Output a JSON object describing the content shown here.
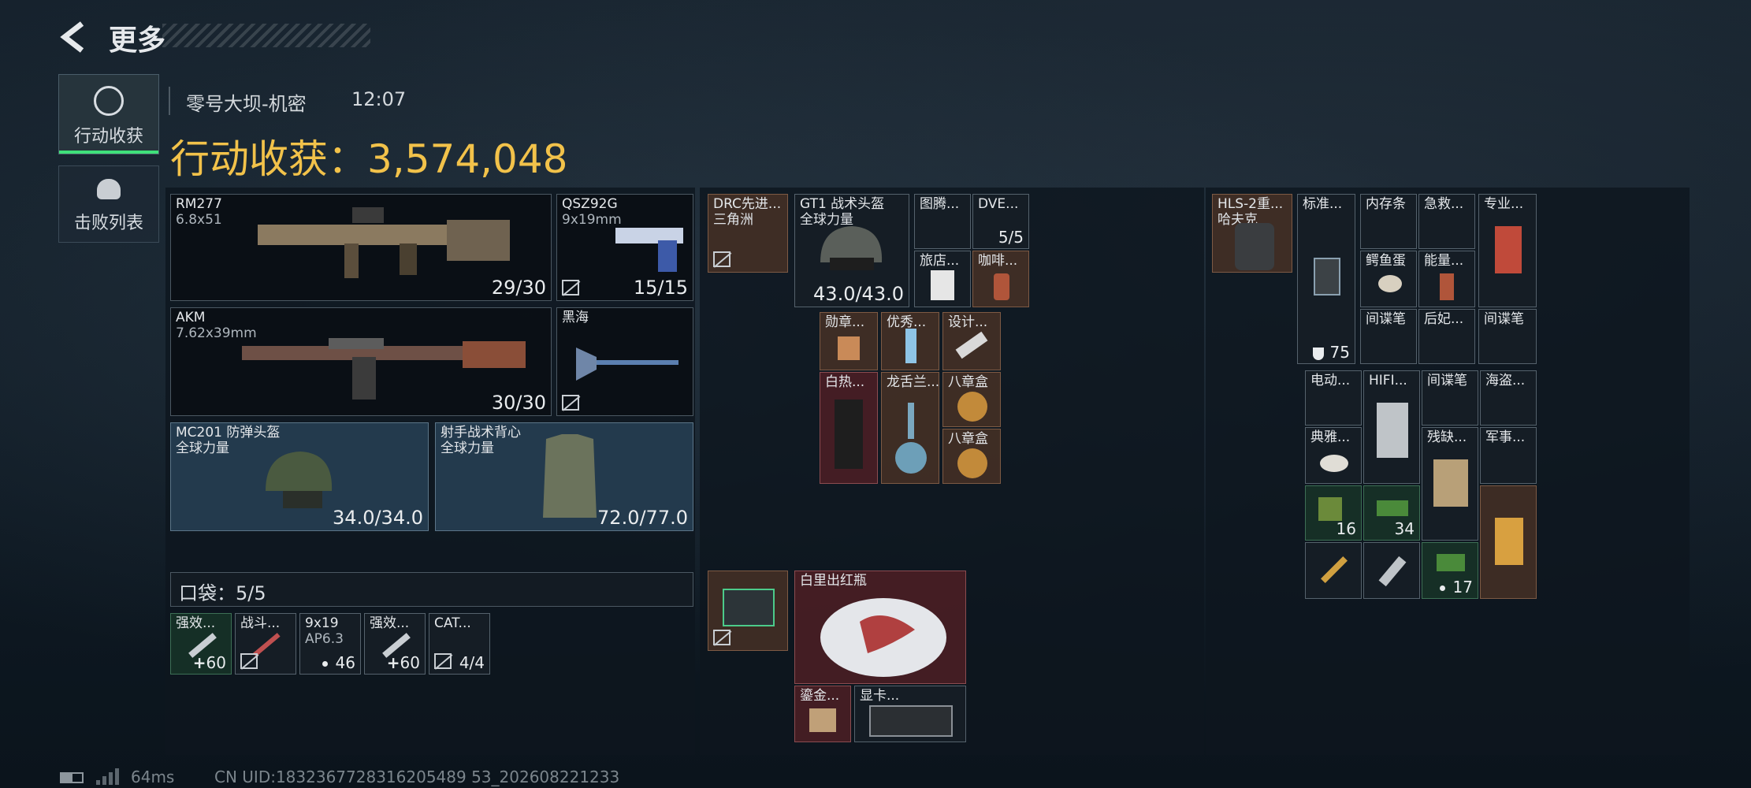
{
  "header": {
    "title": "更多"
  },
  "sidebar": {
    "items": [
      {
        "label": "行动收获"
      },
      {
        "label": "击败列表"
      }
    ]
  },
  "match": {
    "map": "零号大坝-机密",
    "time": "12:07"
  },
  "loot": {
    "label": "行动收获：",
    "value": "3,574,048"
  },
  "gear": {
    "rm277": {
      "name": "RM277",
      "ammo": "6.8x51",
      "count": "29/30"
    },
    "qsz": {
      "name": "QSZ92G",
      "ammo": "9x19mm",
      "count": "15/15"
    },
    "akm": {
      "name": "AKM",
      "ammo": "7.62x39mm",
      "count": "30/30"
    },
    "heihai": {
      "name": "黑海"
    },
    "helmet": {
      "name": "MC201 防弹头盔",
      "faction": "全球力量",
      "dur": "34.0/34.0"
    },
    "vest": {
      "name": "射手战术背心",
      "faction": "全球力量",
      "dur": "72.0/77.0"
    }
  },
  "pocket": {
    "label": "口袋：",
    "count": "5/5",
    "items": [
      {
        "name": "强效...",
        "val": "60"
      },
      {
        "name": "战斗...",
        "val": ""
      },
      {
        "name": "9x19",
        "sub": "AP6.3",
        "val": "46"
      },
      {
        "name": "强效...",
        "val": "60"
      },
      {
        "name": "CAT...",
        "val": "4/4"
      }
    ]
  },
  "rig": {
    "drc": {
      "name": "DRC先进...",
      "sub": "三角洲"
    },
    "gt1": {
      "name": "GT1 战术头盔",
      "sub": "全球力量",
      "dur": "43.0/43.0"
    },
    "tuteng": {
      "name": "图腾..."
    },
    "dve": {
      "name": "DVE...",
      "val": "5/5"
    },
    "lvdian": {
      "name": "旅店..."
    },
    "kafei": {
      "name": "咖啡..."
    },
    "row2": [
      {
        "name": "勋章..."
      },
      {
        "name": "优秀..."
      },
      {
        "name": "设计..."
      }
    ],
    "baire": {
      "name": "白热..."
    },
    "longshelan": {
      "name": "龙舌兰..."
    },
    "bazhang1": {
      "name": "八章盒"
    },
    "bazhang2": {
      "name": "八章盒"
    },
    "vase": {
      "name": "白里出红瓶"
    },
    "jianjin": {
      "name": "鎏金..."
    },
    "xianka": {
      "name": "显卡..."
    }
  },
  "backpack": {
    "hls": {
      "name": "HLS-2重...",
      "sub": "哈夫克"
    },
    "biaozhun": {
      "name": "标准...",
      "val": "75"
    },
    "top": [
      {
        "name": "内存条"
      },
      {
        "name": "急救..."
      },
      {
        "name": "鳄鱼蛋"
      },
      {
        "name": "能量..."
      },
      {
        "name": "间谍笔"
      },
      {
        "name": "后妃..."
      }
    ],
    "zhuanye": {
      "name": "专业..."
    },
    "jiandie2": {
      "name": "间谍笔"
    },
    "grid": [
      {
        "name": "电动..."
      },
      {
        "name": "HIFI..."
      },
      {
        "name": "间谍笔"
      },
      {
        "name": "海盗..."
      },
      {
        "name": "典雅..."
      },
      {
        "name": "残缺..."
      },
      {
        "name": "军事..."
      }
    ],
    "counts": {
      "a": "16",
      "b": "34",
      "c": "17"
    }
  },
  "status": {
    "ping": "64ms",
    "uid": "CN UID:1832367728316205489 53_202608221233"
  },
  "colors": {
    "gold": "#f2c24a",
    "green": "#3fe07a"
  }
}
